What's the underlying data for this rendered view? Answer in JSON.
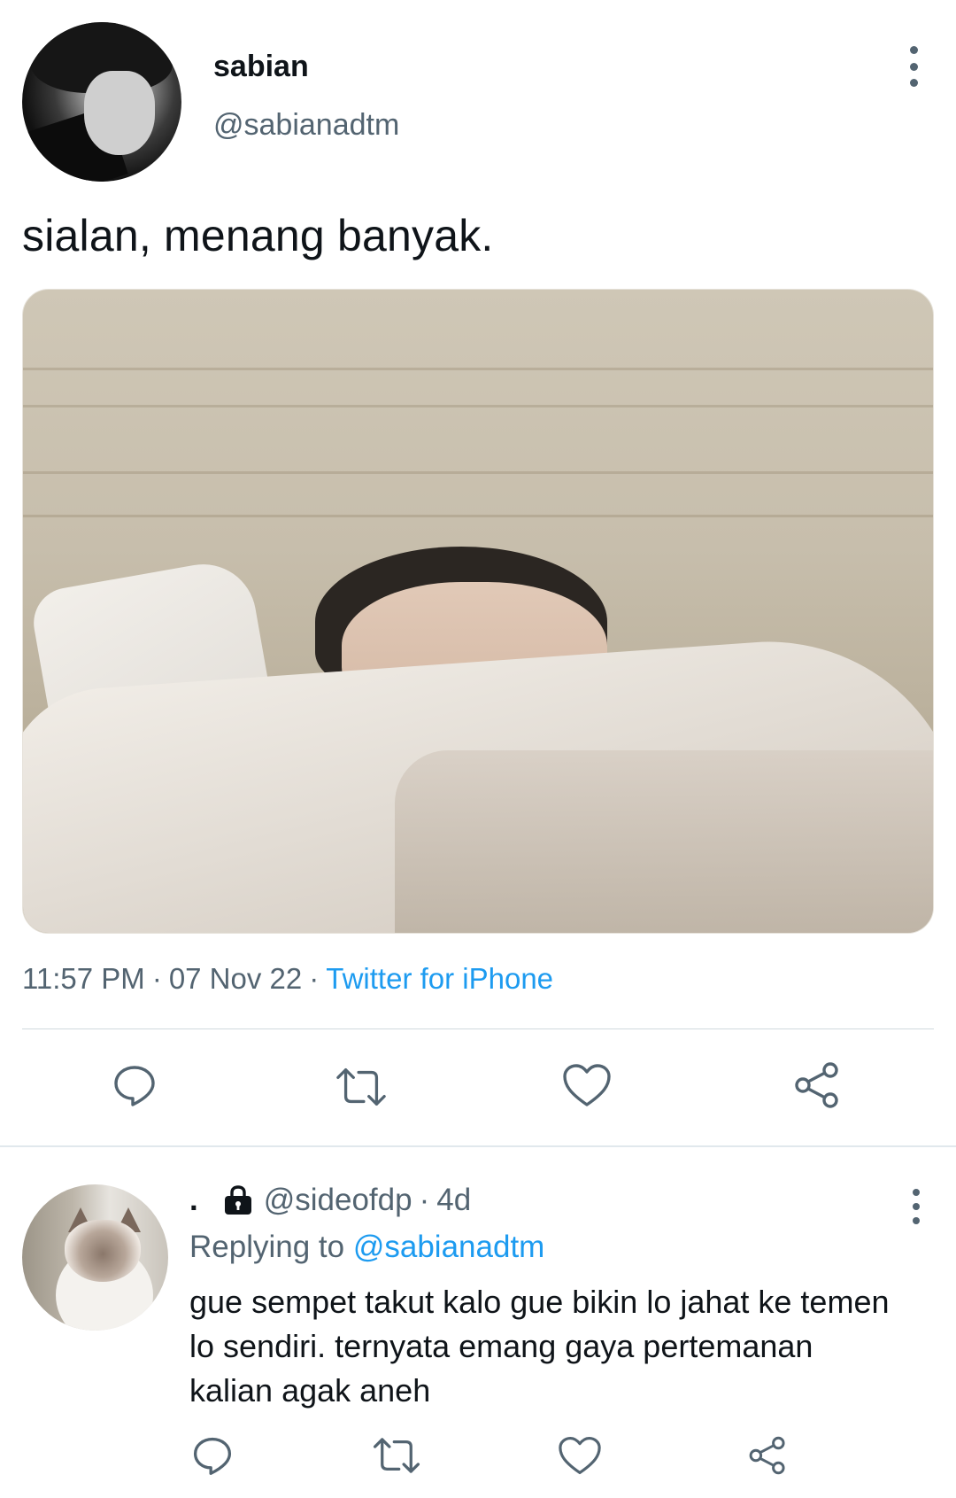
{
  "tweet": {
    "author_name": "sabian",
    "author_handle": "@sabianadtm",
    "text": "sialan, menang banyak.",
    "time": "11:57 PM",
    "date": "07 Nov 22",
    "source": "Twitter for iPhone",
    "separator": "·"
  },
  "reply": {
    "author_name": ".",
    "author_handle": "@sideofdp",
    "age": "4d",
    "separator": "·",
    "replying_prefix": "Replying to",
    "replying_to": "@sabianadtm",
    "text": "gue sempet takut kalo gue bikin lo jahat ke temen lo sendiri. ternyata emang gaya pertemanan kalian agak aneh"
  },
  "colors": {
    "accent": "#1d9bf0",
    "secondary_text": "#536471",
    "primary_text": "#0f1419",
    "divider": "#cfd9de"
  },
  "icons": {
    "reply": "reply-icon",
    "retweet": "retweet-icon",
    "like": "heart-icon",
    "share": "share-icon",
    "more": "more-vertical-icon",
    "protected": "lock-icon"
  }
}
